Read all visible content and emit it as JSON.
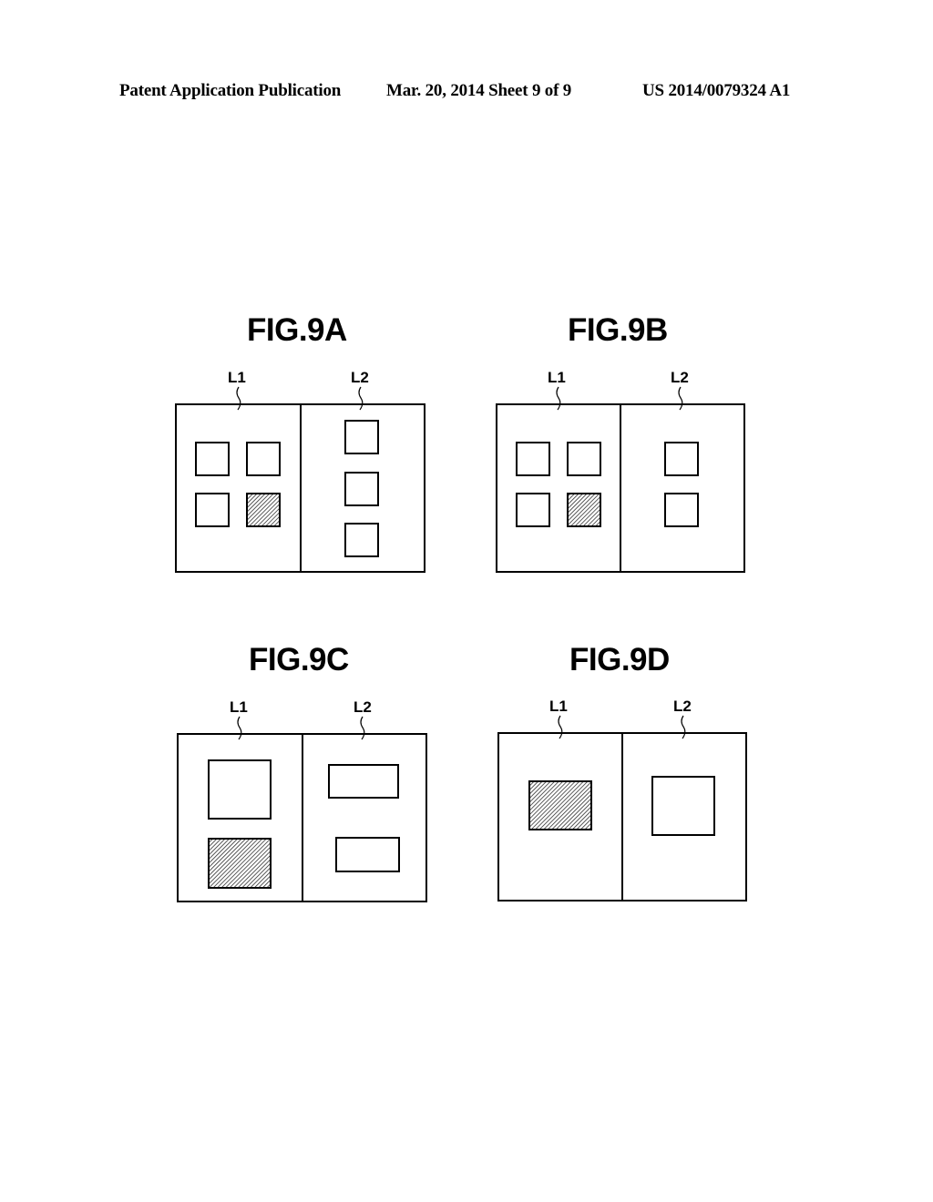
{
  "header": {
    "left": "Patent Application Publication",
    "middle": "Mar. 20, 2014  Sheet 9 of 9",
    "right": "US 2014/0079324 A1"
  },
  "figures": [
    {
      "title": "FIG.9A",
      "region_labels": [
        "L1",
        "L2"
      ],
      "L1_items": [
        {
          "shape": "square",
          "hatched": false
        },
        {
          "shape": "square",
          "hatched": false
        },
        {
          "shape": "square",
          "hatched": false
        },
        {
          "shape": "square",
          "hatched": true
        }
      ],
      "L2_items": [
        {
          "shape": "square",
          "hatched": false
        },
        {
          "shape": "square",
          "hatched": false
        },
        {
          "shape": "square",
          "hatched": false
        }
      ]
    },
    {
      "title": "FIG.9B",
      "region_labels": [
        "L1",
        "L2"
      ],
      "L1_items": [
        {
          "shape": "square",
          "hatched": false
        },
        {
          "shape": "square",
          "hatched": false
        },
        {
          "shape": "square",
          "hatched": false
        },
        {
          "shape": "square",
          "hatched": true
        }
      ],
      "L2_items": [
        {
          "shape": "square",
          "hatched": false
        },
        {
          "shape": "square",
          "hatched": false
        }
      ]
    },
    {
      "title": "FIG.9C",
      "region_labels": [
        "L1",
        "L2"
      ],
      "L1_items": [
        {
          "shape": "large-square",
          "hatched": false
        },
        {
          "shape": "rectangle",
          "hatched": true
        }
      ],
      "L2_items": [
        {
          "shape": "wide-rectangle",
          "hatched": false
        },
        {
          "shape": "wide-rectangle",
          "hatched": false
        }
      ]
    },
    {
      "title": "FIG.9D",
      "region_labels": [
        "L1",
        "L2"
      ],
      "L1_items": [
        {
          "shape": "rectangle",
          "hatched": true
        }
      ],
      "L2_items": [
        {
          "shape": "large-square",
          "hatched": false
        }
      ]
    }
  ]
}
